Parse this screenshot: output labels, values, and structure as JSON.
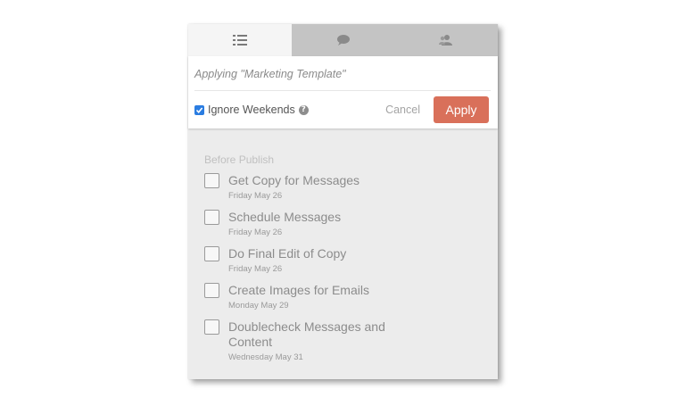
{
  "tabs": [
    {
      "icon": "list-icon",
      "active": true
    },
    {
      "icon": "chat-bubble-icon",
      "active": false
    },
    {
      "icon": "users-icon",
      "active": false
    }
  ],
  "header": {
    "applying_text": "Applying \"Marketing Template\""
  },
  "controls": {
    "ignore_weekends_label": "Ignore Weekends",
    "ignore_weekends_checked": true,
    "help_icon": "?",
    "cancel_label": "Cancel",
    "apply_label": "Apply"
  },
  "section": {
    "title": "Before Publish",
    "tasks": [
      {
        "title": "Get Copy for Messages",
        "date": "Friday May 26"
      },
      {
        "title": "Schedule Messages",
        "date": "Friday May 26"
      },
      {
        "title": "Do Final Edit of Copy",
        "date": "Friday May 26"
      },
      {
        "title": "Create Images for Emails",
        "date": "Monday May 29"
      },
      {
        "title": "Doublecheck Messages and Content",
        "date": "Wednesday May 31"
      }
    ]
  },
  "colors": {
    "accent": "#d9705a",
    "checkbox_blue": "#2b7de1",
    "panel_bg": "#ececec"
  }
}
